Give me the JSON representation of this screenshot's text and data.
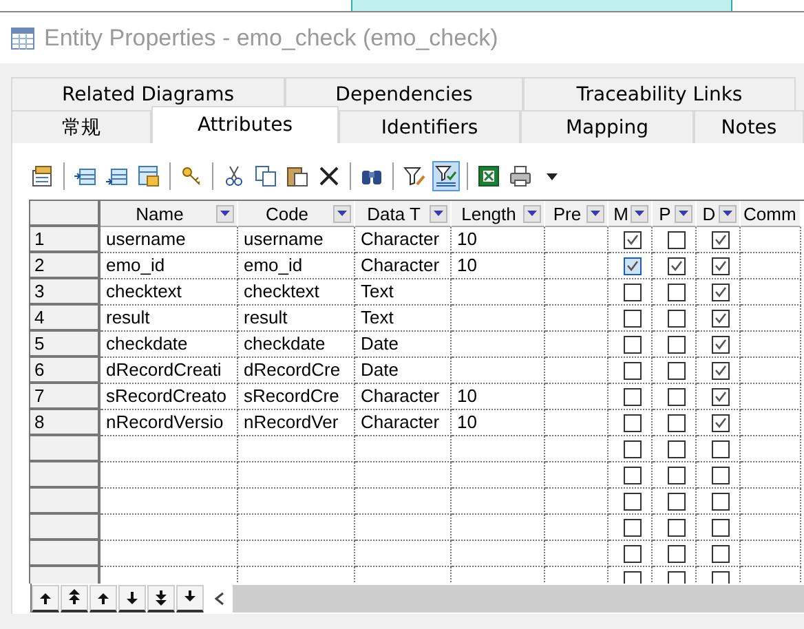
{
  "window": {
    "title": "Entity Properties - emo_check (emo_check)"
  },
  "tab_rows": [
    [
      {
        "label": "Related Diagrams",
        "selected": false
      },
      {
        "label": "Dependencies",
        "selected": false
      },
      {
        "label": "Traceability Links",
        "selected": false
      }
    ],
    [
      {
        "label": "常规",
        "selected": false
      },
      {
        "label": "Attributes",
        "selected": true
      },
      {
        "label": "Identifiers",
        "selected": false
      },
      {
        "label": "Mapping",
        "selected": false
      },
      {
        "label": "Notes",
        "selected": false
      }
    ]
  ],
  "toolbar": [
    [
      {
        "kind": "properties",
        "selected": false
      }
    ],
    [
      {
        "kind": "insert-row",
        "selected": false
      },
      {
        "kind": "add-row",
        "selected": false
      },
      {
        "kind": "add-columns",
        "selected": false
      }
    ],
    [
      {
        "kind": "key",
        "selected": false
      }
    ],
    [
      {
        "kind": "cut",
        "selected": false
      },
      {
        "kind": "copy",
        "selected": false
      },
      {
        "kind": "paste",
        "selected": false
      },
      {
        "kind": "delete",
        "selected": false
      }
    ],
    [
      {
        "kind": "find",
        "selected": false
      }
    ],
    [
      {
        "kind": "filter",
        "selected": false
      },
      {
        "kind": "filter-grid",
        "selected": true
      }
    ],
    [
      {
        "kind": "excel",
        "selected": false
      },
      {
        "kind": "print",
        "selected": false
      },
      {
        "kind": "caret",
        "selected": false
      }
    ]
  ],
  "table": {
    "columns": [
      {
        "label": "Name",
        "kind": "text"
      },
      {
        "label": "Code",
        "kind": "text"
      },
      {
        "label": "Data T",
        "kind": "text"
      },
      {
        "label": "Length",
        "kind": "text"
      },
      {
        "label": "Pre",
        "kind": "text"
      },
      {
        "label": "M",
        "kind": "check"
      },
      {
        "label": "P",
        "kind": "check"
      },
      {
        "label": "D",
        "kind": "check"
      },
      {
        "label": "Comm",
        "kind": "plain"
      }
    ],
    "rows": [
      {
        "number": "1",
        "cells": [
          "username",
          "username",
          "Character",
          "10"
        ],
        "flags": [
          {
            "checked": true,
            "highlighted": false
          },
          {
            "checked": false,
            "highlighted": false
          },
          {
            "checked": true,
            "highlighted": false
          }
        ]
      },
      {
        "number": "2",
        "cells": [
          "emo_id",
          "emo_id",
          "Character",
          "10"
        ],
        "flags": [
          {
            "checked": true,
            "highlighted": true
          },
          {
            "checked": true,
            "highlighted": false
          },
          {
            "checked": true,
            "highlighted": false
          }
        ]
      },
      {
        "number": "3",
        "cells": [
          "checktext",
          "checktext",
          "Text"
        ],
        "flags": [
          {
            "checked": false,
            "highlighted": false
          },
          {
            "checked": false,
            "highlighted": false
          },
          {
            "checked": true,
            "highlighted": false
          }
        ]
      },
      {
        "number": "4",
        "cells": [
          "result",
          "result",
          "Text"
        ],
        "flags": [
          {
            "checked": false,
            "highlighted": false
          },
          {
            "checked": false,
            "highlighted": false
          },
          {
            "checked": true,
            "highlighted": false
          }
        ]
      },
      {
        "number": "5",
        "cells": [
          "checkdate",
          "checkdate",
          "Date"
        ],
        "flags": [
          {
            "checked": false,
            "highlighted": false
          },
          {
            "checked": false,
            "highlighted": false
          },
          {
            "checked": true,
            "highlighted": false
          }
        ]
      },
      {
        "number": "6",
        "cells": [
          "dRecordCreati",
          "dRecordCre",
          "Date"
        ],
        "flags": [
          {
            "checked": false,
            "highlighted": false
          },
          {
            "checked": false,
            "highlighted": false
          },
          {
            "checked": true,
            "highlighted": false
          }
        ]
      },
      {
        "number": "7",
        "cells": [
          "sRecordCreato",
          "sRecordCre",
          "Character",
          "10"
        ],
        "flags": [
          {
            "checked": false,
            "highlighted": false
          },
          {
            "checked": false,
            "highlighted": false
          },
          {
            "checked": true,
            "highlighted": false
          }
        ]
      },
      {
        "number": "8",
        "cells": [
          "nRecordVersio",
          "nRecordVer",
          "Character",
          "10"
        ],
        "flags": [
          {
            "checked": false,
            "highlighted": false
          },
          {
            "checked": false,
            "highlighted": false
          },
          {
            "checked": true,
            "highlighted": false
          }
        ]
      },
      {
        "flags": [
          {
            "checked": false,
            "highlighted": false
          },
          {
            "checked": false,
            "highlighted": false
          },
          {
            "checked": false,
            "highlighted": false
          }
        ]
      },
      {
        "flags": [
          {
            "checked": false,
            "highlighted": false
          },
          {
            "checked": false,
            "highlighted": false
          },
          {
            "checked": false,
            "highlighted": false
          }
        ]
      },
      {
        "flags": [
          {
            "checked": false,
            "highlighted": false
          },
          {
            "checked": false,
            "highlighted": false
          },
          {
            "checked": false,
            "highlighted": false
          }
        ]
      },
      {
        "flags": [
          {
            "checked": false,
            "highlighted": false
          },
          {
            "checked": false,
            "highlighted": false
          },
          {
            "checked": false,
            "highlighted": false
          }
        ]
      },
      {
        "flags": [
          {
            "checked": false,
            "highlighted": false
          },
          {
            "checked": false,
            "highlighted": false
          },
          {
            "checked": false,
            "highlighted": false
          }
        ]
      },
      {
        "flags": [
          {
            "checked": false,
            "highlighted": false
          },
          {
            "checked": false,
            "highlighted": false
          },
          {
            "checked": false,
            "highlighted": false
          }
        ]
      }
    ]
  }
}
